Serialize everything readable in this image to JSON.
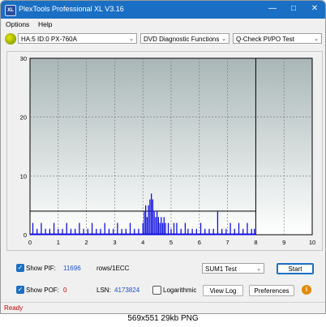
{
  "window": {
    "app_icon_label": "XL",
    "title": "PlexTools Professional XL V3.16",
    "minimize_icon": "minimize-icon",
    "maximize_icon": "maximize-icon",
    "close_icon": "close-icon"
  },
  "menu": {
    "options": "Options",
    "help": "Help"
  },
  "toolbar": {
    "drive": "HA:5 ID:0  PX-760A",
    "function": "DVD Diagnostic Functions",
    "test": "Q-Check PI/PO Test"
  },
  "chart_data": {
    "type": "bar",
    "xlim": [
      0,
      10
    ],
    "ylim": [
      0,
      30
    ],
    "x_ticks": [
      "0",
      "1",
      "2",
      "3",
      "4",
      "5",
      "6",
      "7",
      "8",
      "9",
      "10"
    ],
    "y_ticks": [
      "30",
      "20",
      "10",
      "0"
    ],
    "grid": true,
    "threshold_line": 4,
    "data_end_x": 8,
    "series_color": "#1010e0",
    "bars": [
      [
        0.1,
        2
      ],
      [
        0.25,
        1
      ],
      [
        0.4,
        2
      ],
      [
        0.55,
        1
      ],
      [
        0.7,
        1
      ],
      [
        0.85,
        2
      ],
      [
        1.0,
        1
      ],
      [
        1.15,
        1
      ],
      [
        1.3,
        2
      ],
      [
        1.45,
        1
      ],
      [
        1.6,
        1
      ],
      [
        1.75,
        2
      ],
      [
        1.9,
        1
      ],
      [
        2.05,
        1
      ],
      [
        2.2,
        2
      ],
      [
        2.35,
        1
      ],
      [
        2.5,
        1
      ],
      [
        2.65,
        2
      ],
      [
        2.8,
        1
      ],
      [
        2.95,
        1
      ],
      [
        3.1,
        2
      ],
      [
        3.25,
        1
      ],
      [
        3.4,
        1
      ],
      [
        3.55,
        2
      ],
      [
        3.7,
        1
      ],
      [
        3.85,
        1
      ],
      [
        4.0,
        2
      ],
      [
        4.05,
        4
      ],
      [
        4.1,
        5
      ],
      [
        4.15,
        3
      ],
      [
        4.2,
        5
      ],
      [
        4.25,
        6
      ],
      [
        4.3,
        7
      ],
      [
        4.35,
        6
      ],
      [
        4.4,
        4
      ],
      [
        4.45,
        3
      ],
      [
        4.5,
        4
      ],
      [
        4.55,
        3
      ],
      [
        4.6,
        2
      ],
      [
        4.65,
        3
      ],
      [
        4.7,
        2
      ],
      [
        4.75,
        3
      ],
      [
        4.8,
        2
      ],
      [
        4.9,
        2
      ],
      [
        5.0,
        1
      ],
      [
        5.1,
        2
      ],
      [
        5.2,
        2
      ],
      [
        5.35,
        1
      ],
      [
        5.5,
        2
      ],
      [
        5.6,
        1
      ],
      [
        5.75,
        1
      ],
      [
        5.9,
        1
      ],
      [
        6.05,
        2
      ],
      [
        6.2,
        1
      ],
      [
        6.35,
        1
      ],
      [
        6.5,
        1
      ],
      [
        6.65,
        4
      ],
      [
        6.8,
        1
      ],
      [
        6.95,
        1
      ],
      [
        7.1,
        2
      ],
      [
        7.25,
        1
      ],
      [
        7.4,
        2
      ],
      [
        7.55,
        1
      ],
      [
        7.7,
        2
      ],
      [
        7.85,
        1
      ],
      [
        7.95,
        1
      ]
    ]
  },
  "bottom": {
    "show_pif_label": "Show PIF:",
    "pif_value": "11696",
    "rows_label": "rows/1ECC",
    "show_pof_label": "Show POF:",
    "pof_value": "0",
    "lsn_label": "LSN:",
    "lsn_value": "4173824",
    "logarithmic_label": "Logarithmic",
    "sum_select": "SUM1 Test",
    "start": "Start",
    "view_log": "View Log",
    "preferences": "Preferences",
    "info_icon": "info-icon",
    "check_mark": "✓"
  },
  "status": {
    "text": "Ready"
  },
  "caption": "569x551  29kb  PNG",
  "colors": {
    "titlebar": "#1a6fc4",
    "status_text": "#d00000",
    "pif_value": "#1a4fd0",
    "pof_value": "#d00000",
    "lsn_value": "#1a4fd0"
  }
}
